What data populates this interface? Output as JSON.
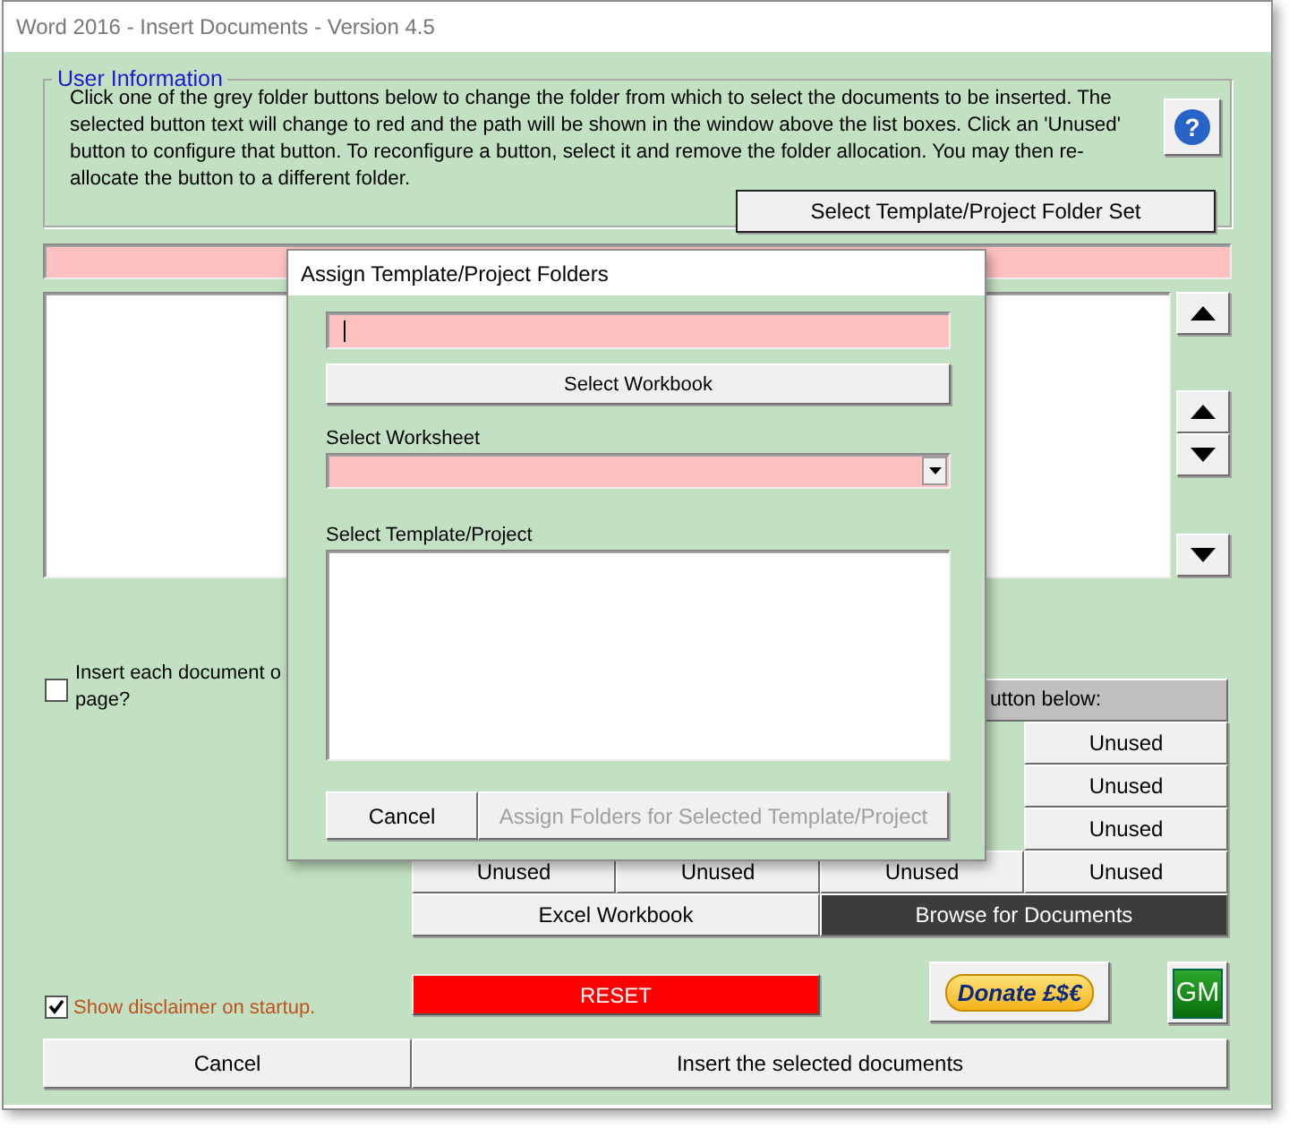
{
  "window": {
    "title": "Word 2016 - Insert Documents - Version 4.5"
  },
  "user_information": {
    "legend": "User Information",
    "text": "Click one of the grey folder buttons below to change the folder from which to select the documents to be inserted. The selected button text will change to red and the path will be shown in the window above the list boxes. Click an 'Unused' button to configure that button. To reconfigure a button, select it and remove the folder allocation. You may then re-allocate the button to a different folder.",
    "help_button": "?",
    "folder_set_button": "Select Template/Project Folder Set"
  },
  "list_buttons": [
    {
      "kind": "up"
    },
    {
      "kind": "up"
    },
    {
      "kind": "down"
    },
    {
      "kind": "down"
    }
  ],
  "insert_checkbox": {
    "label_lines": [
      "Insert each document o",
      "page?"
    ],
    "checked": false
  },
  "folder_grid": {
    "header": "utton below:",
    "rows": [
      [
        "Unused"
      ],
      [
        "Unused"
      ],
      [
        "Unused"
      ],
      [
        "Unused",
        "Unused",
        "Unused",
        "Unused"
      ]
    ]
  },
  "source_buttons": [
    {
      "label": "Excel Workbook",
      "selected": false
    },
    {
      "label": "Browse for Documents",
      "selected": true
    }
  ],
  "disclaimer_checkbox": {
    "label": "Show disclaimer on startup.",
    "checked": true
  },
  "reset_button": "RESET",
  "donate_button": "Donate £$€",
  "gm_button": "GM",
  "footer_buttons": [
    "Cancel",
    "Insert the selected documents"
  ],
  "dialog": {
    "title": "Assign Template/Project Folders",
    "workbook_field": {
      "focused": true
    },
    "select_workbook_button": "Select Workbook",
    "worksheet_label": "Select Worksheet",
    "template_label": "Select Template/Project",
    "buttons": [
      {
        "label": "Cancel",
        "disabled": false
      },
      {
        "label": "Assign Folders for Selected Template/Project",
        "disabled": true
      }
    ]
  }
}
